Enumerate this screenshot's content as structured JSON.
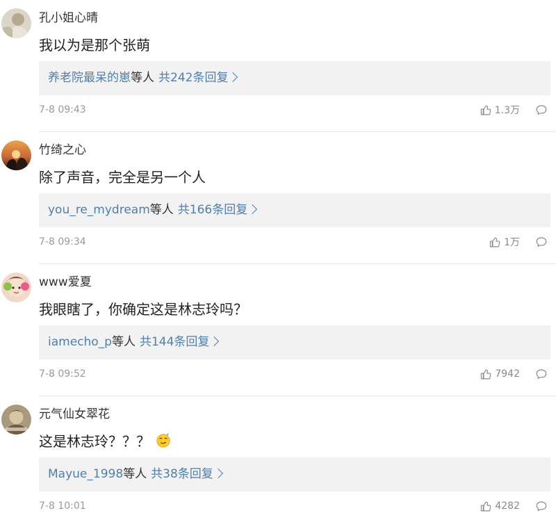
{
  "comments": [
    {
      "username": "孔小姐心晴",
      "text": "我以为是那个张萌",
      "reply_users": "养老院最呆的崽",
      "reply_etc": "等人",
      "reply_count": "共242条回复",
      "time": "7-8 09:43",
      "likes": "1.3万",
      "avatar_icon": "avatar-photo-icon",
      "emoji": ""
    },
    {
      "username": "竹绮之心",
      "text": "除了声音，完全是另一个人",
      "reply_users": "you_re_mydream",
      "reply_etc": "等人",
      "reply_count": "共166条回复",
      "time": "7-8 09:34",
      "likes": "1万",
      "avatar_icon": "avatar-photo-icon",
      "emoji": ""
    },
    {
      "username": "www爱夏",
      "text": "我眼瞎了，你确定这是林志玲吗？",
      "reply_users": "iamecho_p",
      "reply_etc": "等人",
      "reply_count": "共144条回复",
      "time": "7-8 09:52",
      "likes": "7942",
      "avatar_icon": "avatar-photo-icon",
      "emoji": ""
    },
    {
      "username": "元气仙女翠花",
      "text": "这是林志玲？？？",
      "reply_users": "Mayue_1998",
      "reply_etc": "等人",
      "reply_count": "共38条回复",
      "time": "7-8 10:01",
      "likes": "4282",
      "avatar_icon": "avatar-photo-icon",
      "emoji": "doge-emoji-icon"
    }
  ],
  "icons": {
    "like": "thumbs-up-icon",
    "comment": "comment-bubble-icon",
    "reply_arrow": "chevron-right-icon"
  },
  "colors": {
    "link": "#4e7fad",
    "reply_bg": "#f2f2f2",
    "meta_text": "#999999"
  }
}
